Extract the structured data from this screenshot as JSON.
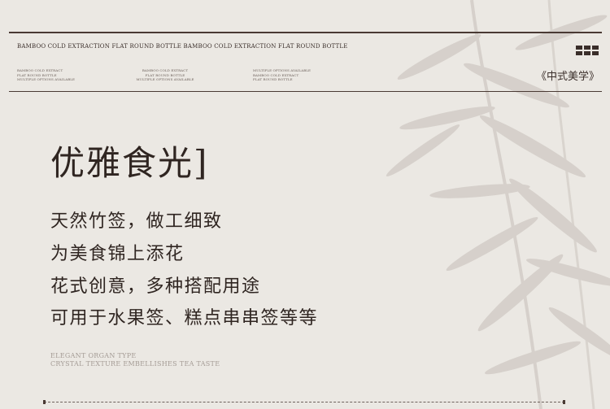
{
  "header": {
    "repeat_line": "BAMBOO COLD EXTRACTION FLAT ROUND BOTTLE BAMBOO COLD EXTRACTION FLAT ROUND BOTTLE",
    "micro_blocks": [
      [
        "BAMBOO COLD EXTRACT",
        "FLAT ROUND BOTTLE",
        "MULTIPLE OPTIONS AVAILABLE"
      ],
      [
        "BAMBOO COLD EXTRACT",
        "FLAT ROUND BOTTLE",
        "MULTIPLE OPTIONS AVAILABLE"
      ],
      [
        "MULTIPLE OPTIONS AVAILABLE",
        "BAMBOO COLD EXTRACT",
        "FLAT ROUND BOTTLE"
      ]
    ],
    "tag": "《中式美学》",
    "grid_icon": "grid-icon"
  },
  "content": {
    "title": "优雅食光]",
    "lines": [
      "天然竹签，做工细致",
      "为美食锦上添花",
      "花式创意，多种搭配用途",
      "可用于水果签、糕点串串签等等"
    ],
    "captions": [
      "ELEGANT ORGAN TYPE",
      "CRYSTAL TEXTURE EMBELLISHES TEA TASTE"
    ]
  },
  "decor": {
    "background_image": "bamboo-leaves-illustration"
  },
  "colors": {
    "background": "#ebe8e3",
    "text": "#2f2521",
    "rule": "#4a3a34",
    "caption": "#a49b95",
    "bamboo": "#cfc9c3"
  }
}
